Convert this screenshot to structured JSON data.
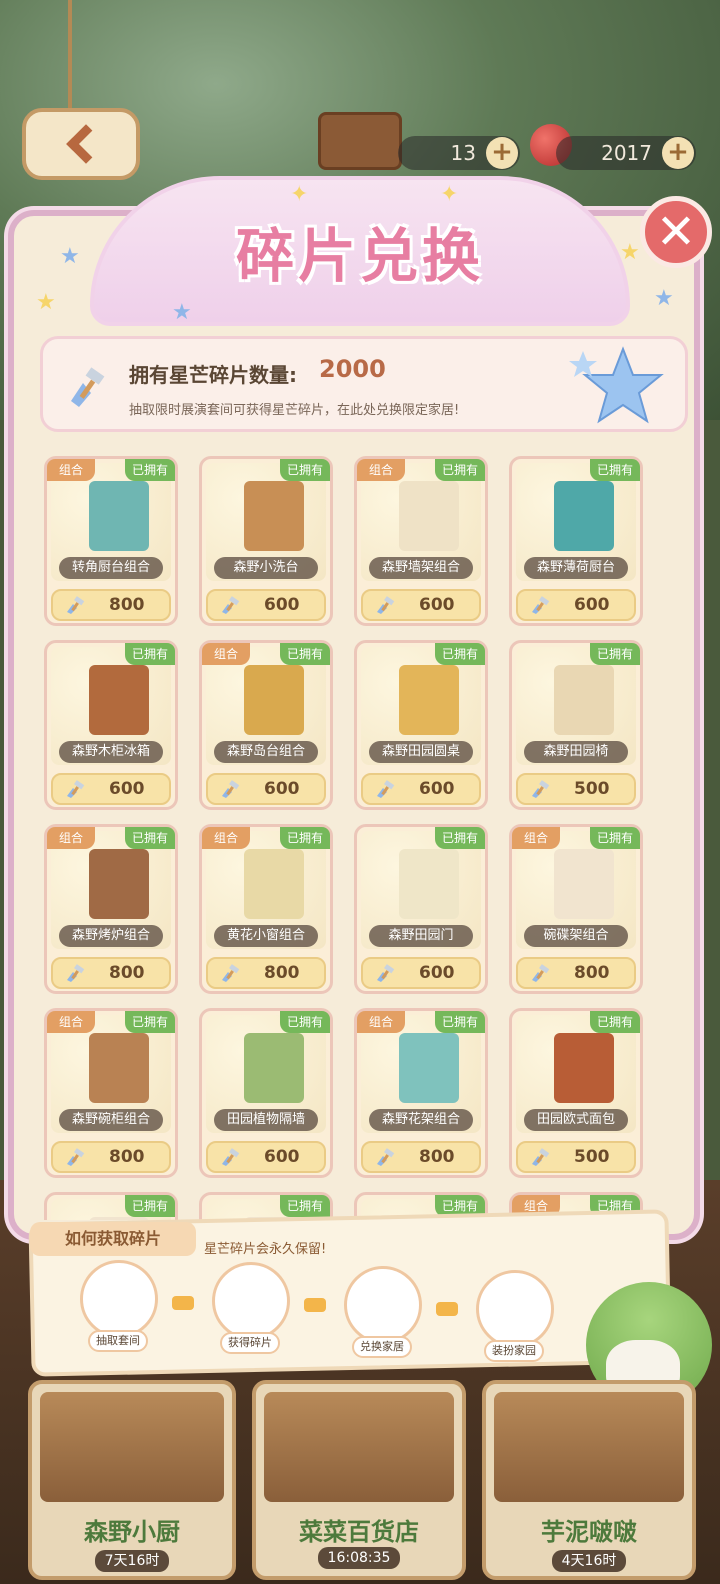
{
  "header": {
    "resource1_value": "13",
    "resource2_value": "2017",
    "plus": "+"
  },
  "panel": {
    "title": "碎片兑换",
    "close": "✕",
    "shard_label": "拥有星芒碎片数量:",
    "shard_count": "2000",
    "shard_tip": "抽取限时展演套间可获得星芒碎片，在此处兑换限定家居!"
  },
  "tags": {
    "combo": "组合",
    "owned": "已拥有"
  },
  "items": [
    {
      "name": "转角厨台组合",
      "price": "800",
      "combo": true,
      "color": "#6fb6b2"
    },
    {
      "name": "森野小洗台",
      "price": "600",
      "combo": false,
      "color": "#c88f55"
    },
    {
      "name": "森野墙架组合",
      "price": "600",
      "combo": true,
      "color": "#efe2c6"
    },
    {
      "name": "森野薄荷厨台",
      "price": "600",
      "combo": false,
      "color": "#4fa8a8"
    },
    {
      "name": "森野木柜冰箱",
      "price": "600",
      "combo": false,
      "color": "#b26a3d"
    },
    {
      "name": "森野岛台组合",
      "price": "600",
      "combo": true,
      "color": "#d9a94e"
    },
    {
      "name": "森野田园圆桌",
      "price": "600",
      "combo": false,
      "color": "#e3b559"
    },
    {
      "name": "森野田园椅",
      "price": "500",
      "combo": false,
      "color": "#e9d7b3"
    },
    {
      "name": "森野烤炉组合",
      "price": "800",
      "combo": true,
      "color": "#a06a45"
    },
    {
      "name": "黄花小窗组合",
      "price": "800",
      "combo": true,
      "color": "#e8d9a6"
    },
    {
      "name": "森野田园门",
      "price": "600",
      "combo": false,
      "color": "#efe6c8"
    },
    {
      "name": "碗碟架组合",
      "price": "800",
      "combo": true,
      "color": "#f1e4cf"
    },
    {
      "name": "森野碗柜组合",
      "price": "800",
      "combo": true,
      "color": "#b98253"
    },
    {
      "name": "田园植物隔墙",
      "price": "600",
      "combo": false,
      "color": "#9bbb73"
    },
    {
      "name": "森野花架组合",
      "price": "800",
      "combo": true,
      "color": "#7fc2bd"
    },
    {
      "name": "田园欧式面包",
      "price": "500",
      "combo": false,
      "color": "#b85d36"
    },
    {
      "name": "",
      "price": "",
      "combo": false,
      "color": "#f1e4cf"
    },
    {
      "name": "",
      "price": "",
      "combo": false,
      "color": "#f1e4cf"
    },
    {
      "name": "",
      "price": "",
      "combo": false,
      "color": "#f1e4cf"
    },
    {
      "name": "",
      "price": "",
      "combo": true,
      "color": "#f1e4cf"
    }
  ],
  "howto": {
    "title": "如何获取碎片",
    "note": "星芒碎片会永久保留!",
    "steps": [
      "抽取套间",
      "获得碎片",
      "兑换家居",
      "装扮家园"
    ]
  },
  "stages": [
    {
      "name": "森野小厨",
      "time": "7天16时"
    },
    {
      "name": "菜菜百货店",
      "time": "16:08:35"
    },
    {
      "name": "芋泥啵啵",
      "time": "4天16时"
    }
  ],
  "colors": {
    "title_pink": "#e77ea2",
    "owned_green": "#75b85a",
    "combo_orange": "#e39f63",
    "close_red": "#e46a6a"
  }
}
